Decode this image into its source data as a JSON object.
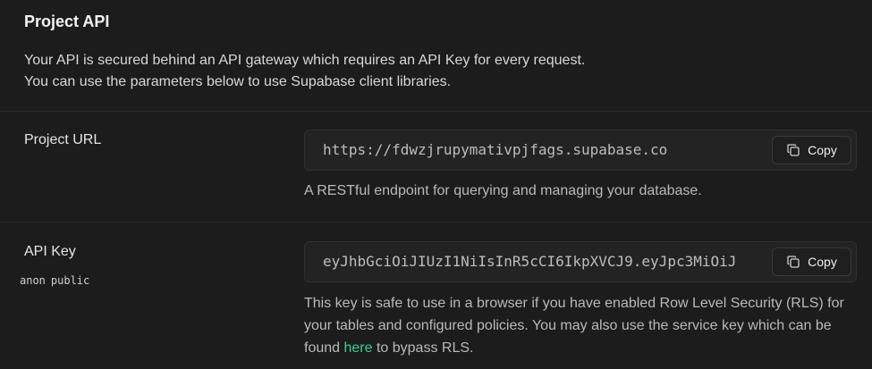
{
  "section": {
    "title": "Project API",
    "description_line1": "Your API is secured behind an API gateway which requires an API Key for every request.",
    "description_line2": "You can use the parameters below to use Supabase client libraries."
  },
  "project_url": {
    "label": "Project URL",
    "value": "https://fdwzjrupymativpjfags.supabase.co",
    "copy_label": "Copy",
    "help": "A RESTful endpoint for querying and managing your database."
  },
  "api_key": {
    "label": "API Key",
    "tags": [
      "anon",
      "public"
    ],
    "value": "eyJhbGciOiJIUzI1NiIsInR5cCI6IkpXVCJ9.eyJpc3MiOiJ",
    "copy_label": "Copy",
    "help_before": "This key is safe to use in a browser if you have enabled Row Level Security (RLS) for your tables and configured policies. You may also use the service key which can be found ",
    "help_link": "here",
    "help_after": " to bypass RLS."
  },
  "colors": {
    "background": "#1c1c1c",
    "accent_link": "#3ecf8e"
  },
  "icons": {
    "copy": "copy-icon"
  }
}
